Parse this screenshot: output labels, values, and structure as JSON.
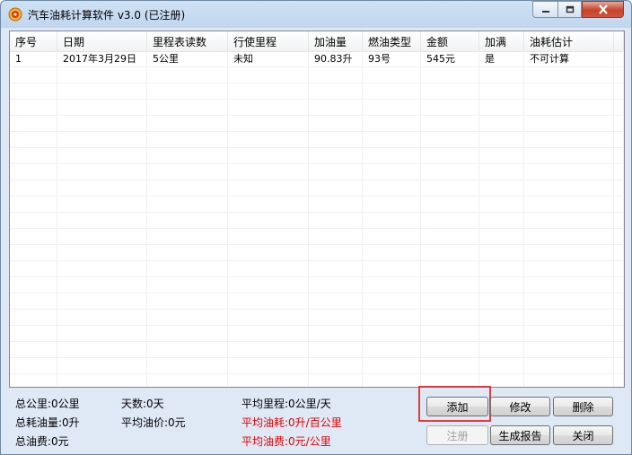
{
  "window": {
    "title": "汽车油耗计算软件 v3.0 (已注册)",
    "icons": {
      "app": "fuel-app-icon",
      "minimize": "minimize-icon",
      "maximize": "maximize-icon",
      "close": "close-icon"
    }
  },
  "table": {
    "columns": [
      "序号",
      "日期",
      "里程表读数",
      "行使里程",
      "加油量",
      "燃油类型",
      "金额",
      "加满",
      "油耗估计"
    ],
    "rows": [
      [
        "1",
        "2017年3月29日",
        "5公里",
        "未知",
        "90.83升",
        "93号",
        "545元",
        "是",
        "不可计算"
      ]
    ]
  },
  "stats": {
    "total_distance": "总公里:0公里",
    "total_fuel": "总耗油量:0升",
    "total_cost": "总油费:0元",
    "days": "天数:0天",
    "avg_price": "平均油价:0元",
    "avg_distance": "平均里程:0公里/天",
    "avg_consumption": "平均油耗:0升/百公里",
    "avg_cost": "平均油费:0元/公里"
  },
  "buttons": {
    "add": "添加",
    "edit": "修改",
    "delete": "删除",
    "register": "注册",
    "report": "生成报告",
    "close": "关闭"
  },
  "colors": {
    "highlight": "#e23b3b",
    "warning_text": "#e00000"
  }
}
